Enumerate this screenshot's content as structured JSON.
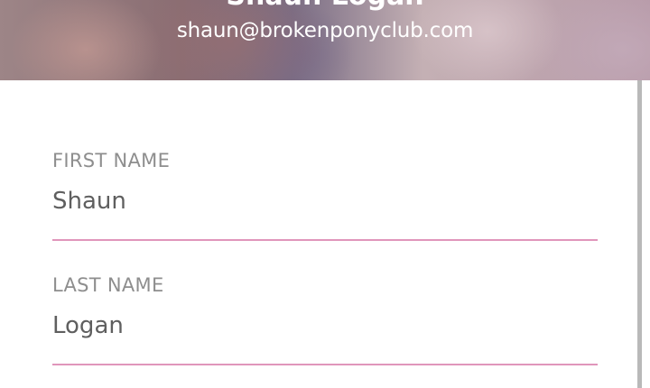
{
  "profile": {
    "name": "Shaun Logan",
    "email": "shaun@brokenponyclub.com"
  },
  "form": {
    "first_name": {
      "label": "FIRST NAME",
      "value": "Shaun"
    },
    "last_name": {
      "label": "LAST NAME",
      "value": "Logan"
    }
  },
  "colors": {
    "underline": "#e096bb",
    "label": "#8e8e8e",
    "input_text": "#5f5f5f"
  }
}
